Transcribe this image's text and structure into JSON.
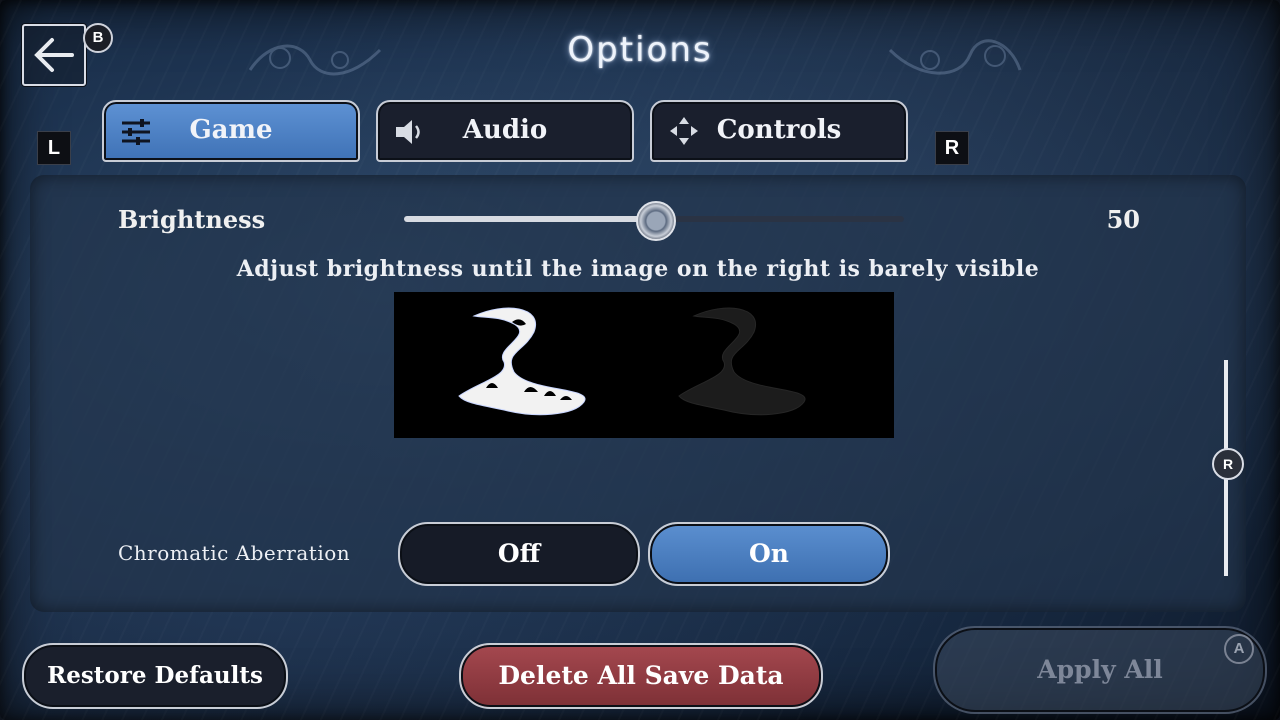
{
  "header": {
    "title": "Options",
    "back_badge": "B",
    "left_shoulder": "L",
    "right_shoulder": "R"
  },
  "tabs": [
    {
      "label": "Game",
      "icon": "sliders-icon",
      "active": true
    },
    {
      "label": "Audio",
      "icon": "speaker-icon",
      "active": false
    },
    {
      "label": "Controls",
      "icon": "dpad-icon",
      "active": false
    }
  ],
  "settings": {
    "brightness": {
      "label": "Brightness",
      "value": "50",
      "level": 0.5
    },
    "hint": "Adjust brightness until the image on the right is barely visible",
    "chromatic_aberration": {
      "label": "Chromatic Aberration",
      "options": [
        "Off",
        "On"
      ],
      "selected": "On"
    },
    "scroll_badge": "R"
  },
  "footer": {
    "restore": "Restore Defaults",
    "delete": "Delete All Save Data",
    "apply": "Apply All",
    "apply_badge": "A"
  },
  "colors": {
    "accent_active": "#4f83c6",
    "danger": "#9a4148",
    "panel": "#23344c"
  }
}
